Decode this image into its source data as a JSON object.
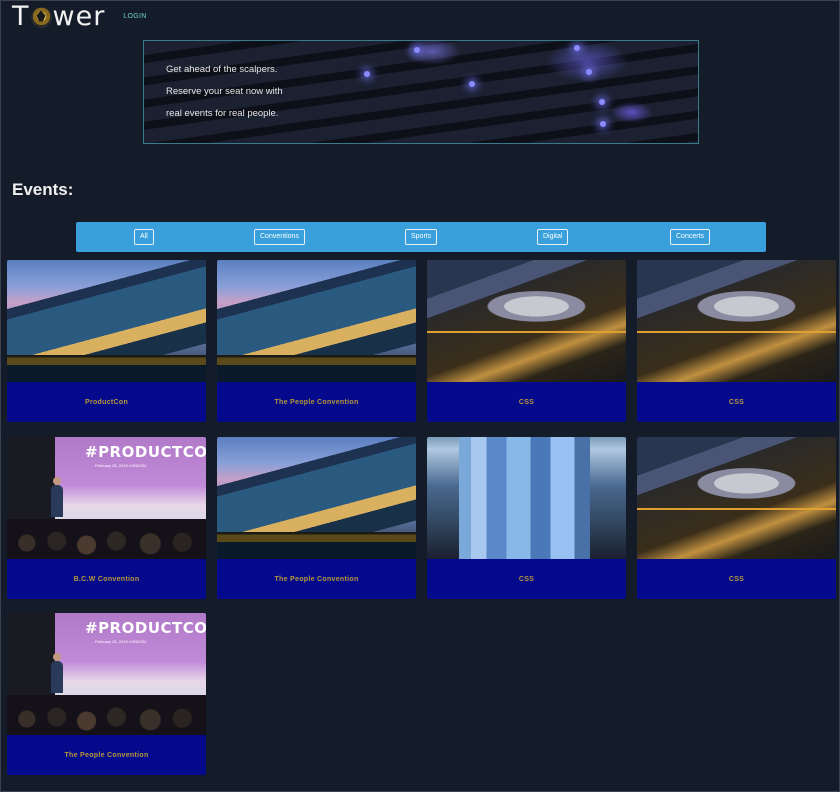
{
  "nav": {
    "brand_prefix": "T",
    "brand_suffix": "wer",
    "login_label": "LOGIN"
  },
  "hero": {
    "lines": [
      "Get ahead of the scalpers.",
      "Reserve your seat now with",
      "real events for real people."
    ]
  },
  "events": {
    "heading": "Events:",
    "filters": [
      "All",
      "Conventions",
      "Sports",
      "Digital",
      "Concerts"
    ],
    "cards": [
      {
        "title": "ProductCon",
        "image": "stadium-image"
      },
      {
        "title": "The People Convention",
        "image": "stadium-image"
      },
      {
        "title": "CSS",
        "image": "arena-image"
      },
      {
        "title": "CSS",
        "image": "arena-image"
      },
      {
        "title": "B.C.W Convention",
        "image": "conference-image"
      },
      {
        "title": "The People Convention",
        "image": "stadium-image"
      },
      {
        "title": "CSS",
        "image": "glass-building-image"
      },
      {
        "title": "CSS",
        "image": "arena-image"
      },
      {
        "title": "The People Convention",
        "image": "conference-image"
      }
    ],
    "conference_banner": "#PRODUCTCON",
    "conference_sub": "February 28, 2019   LONDON"
  },
  "colors": {
    "background": "#141c2a",
    "filter_bar": "#3aa0dc",
    "card_footer": "#050a8c",
    "card_title": "#b8963a",
    "login": "#6ad3c0"
  }
}
